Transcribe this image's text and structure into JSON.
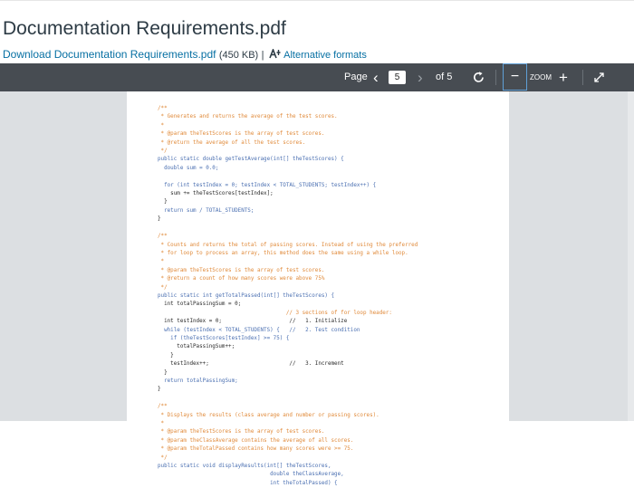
{
  "document": {
    "title": "Documentation Requirements.pdf",
    "download_link": "Download Documentation Requirements.pdf",
    "file_size": "(450 KB)",
    "separator": "|",
    "alternative_formats": "Alternative formats"
  },
  "toolbar": {
    "page_label": "Page",
    "prev_glyph": "‹",
    "current_page": "5",
    "next_glyph": "›",
    "of_label": "of 5",
    "zoom_minus": "−",
    "zoom_label": "ZOOM",
    "zoom_plus": "+"
  },
  "code_lines": [
    {
      "t": "/**",
      "s": "c"
    },
    {
      "t": " * Generates and returns the average of the test scores.",
      "s": "c"
    },
    {
      "t": " *",
      "s": "c"
    },
    {
      "t": " * @param theTestScores is the array of test scores.",
      "s": "c"
    },
    {
      "t": " * @return the average of all the test scores.",
      "s": "c"
    },
    {
      "t": " */",
      "s": "c"
    },
    {
      "t": "public static double getTestAverage(int[] theTestScores) {",
      "s": "k"
    },
    {
      "t": "  double sum = 0.0;",
      "s": "k"
    },
    {
      "t": "",
      "s": "t"
    },
    {
      "t": "  for (int testIndex = 0; testIndex < TOTAL_STUDENTS; testIndex++) {",
      "s": "k"
    },
    {
      "t": "    sum += theTestScores[testIndex];",
      "s": "t"
    },
    {
      "t": "  }",
      "s": "t"
    },
    {
      "t": "  return sum / TOTAL_STUDENTS;",
      "s": "k"
    },
    {
      "t": "}",
      "s": "t"
    },
    {
      "t": "",
      "s": "t"
    },
    {
      "t": "/**",
      "s": "c"
    },
    {
      "t": " * Counts and returns the total of passing scores. Instead of using the preferred",
      "s": "c"
    },
    {
      "t": " * for loop to process an array, this method does the same using a while loop.",
      "s": "c"
    },
    {
      "t": " *",
      "s": "c"
    },
    {
      "t": " * @param theTestScores is the array of test scores.",
      "s": "c"
    },
    {
      "t": " * @return a count of how many scores were above 75%",
      "s": "c"
    },
    {
      "t": " */",
      "s": "c"
    },
    {
      "t": "public static int getTotalPassed(int[] theTestScores) {",
      "s": "k"
    },
    {
      "t": "  int totalPassingSum = 0;",
      "s": "t"
    },
    {
      "t": "                                        // 3 sections of for loop header:",
      "s": "c"
    },
    {
      "t": "  int testIndex = 0;                     //   1. Initialize",
      "s": "t"
    },
    {
      "t": "  while (testIndex < TOTAL_STUDENTS) {   //   2. Test condition",
      "s": "k"
    },
    {
      "t": "    if (theTestScores[testIndex] >= 75) {",
      "s": "k"
    },
    {
      "t": "      totalPassingSum++;",
      "s": "t"
    },
    {
      "t": "    }",
      "s": "t"
    },
    {
      "t": "    testIndex++;                         //   3. Increment",
      "s": "t"
    },
    {
      "t": "  }",
      "s": "t"
    },
    {
      "t": "  return totalPassingSum;",
      "s": "k"
    },
    {
      "t": "}",
      "s": "t"
    },
    {
      "t": "",
      "s": "t"
    },
    {
      "t": "/**",
      "s": "c"
    },
    {
      "t": " * Displays the results (class average and number or passing scores).",
      "s": "c"
    },
    {
      "t": " *",
      "s": "c"
    },
    {
      "t": " * @param theTestScores is the array of test scores.",
      "s": "c"
    },
    {
      "t": " * @param theClassAverage contains the average of all scores.",
      "s": "c"
    },
    {
      "t": " * @param theTotalPassed contains how many scores were >= 75.",
      "s": "c"
    },
    {
      "t": " */",
      "s": "c"
    },
    {
      "t": "public static void displayResults(int[] theTestScores,",
      "s": "k"
    },
    {
      "t": "                                   double theClassAverage,",
      "s": "k"
    },
    {
      "t": "                                   int theTotalPassed) {",
      "s": "k"
    }
  ]
}
